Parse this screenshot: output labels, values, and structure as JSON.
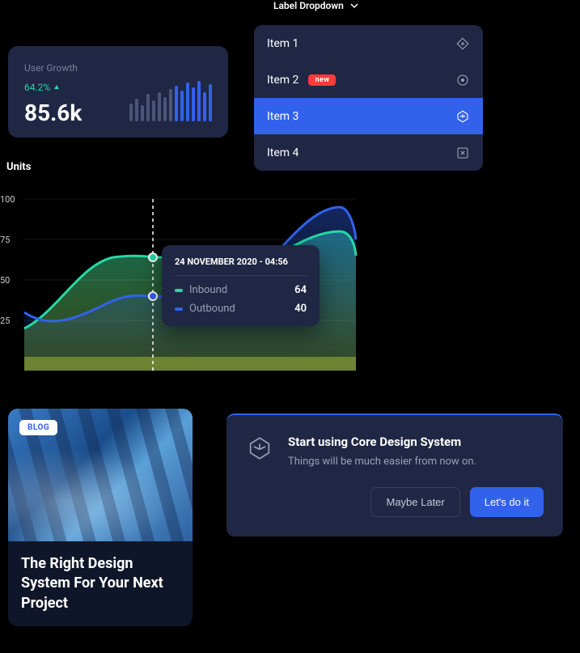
{
  "dropdown_label": "Label Dropdown",
  "stat_card": {
    "label": "User Growth",
    "change": "64.2%",
    "value": "85.6k"
  },
  "dropdown_menu": {
    "items": [
      {
        "label": "Item 1",
        "icon": "diamond-plus-icon",
        "selected": false
      },
      {
        "label": "Item 2",
        "icon": "circle-dot-icon",
        "badge": "new",
        "selected": false
      },
      {
        "label": "Item 3",
        "icon": "hexagon-icon",
        "selected": true
      },
      {
        "label": "Item 4",
        "icon": "x-square-icon",
        "selected": false
      }
    ]
  },
  "chart": {
    "ylabel": "Units",
    "tooltip": {
      "date": "24 NOVEMBER 2020 - 04:56",
      "series": [
        {
          "name": "Inbound",
          "value": "64",
          "color": "#25d9a5"
        },
        {
          "name": "Outbound",
          "value": "40",
          "color": "#3262ec"
        }
      ]
    }
  },
  "chart_data": {
    "type": "line",
    "ylabel": "Units",
    "ylim": [
      0,
      100
    ],
    "yticks": [
      25,
      50,
      75,
      100
    ],
    "x_marker_index": 3,
    "series": [
      {
        "name": "Inbound",
        "color": "#25d9a5",
        "values": [
          20,
          40,
          65,
          64,
          48,
          55,
          78,
          80,
          65
        ]
      },
      {
        "name": "Outbound",
        "color": "#3262ec",
        "values": [
          30,
          20,
          35,
          40,
          38,
          30,
          62,
          95,
          75
        ]
      }
    ],
    "tooltip_at": {
      "timestamp": "24 NOVEMBER 2020 - 04:56",
      "inbound": 64,
      "outbound": 40
    }
  },
  "blog": {
    "badge": "BLOG",
    "title": "The Right Design System For Your Next Project"
  },
  "cta": {
    "title": "Start using Core Design System",
    "subtitle": "Things will be much easier from now on.",
    "secondary": "Maybe Later",
    "primary": "Let's do it"
  }
}
